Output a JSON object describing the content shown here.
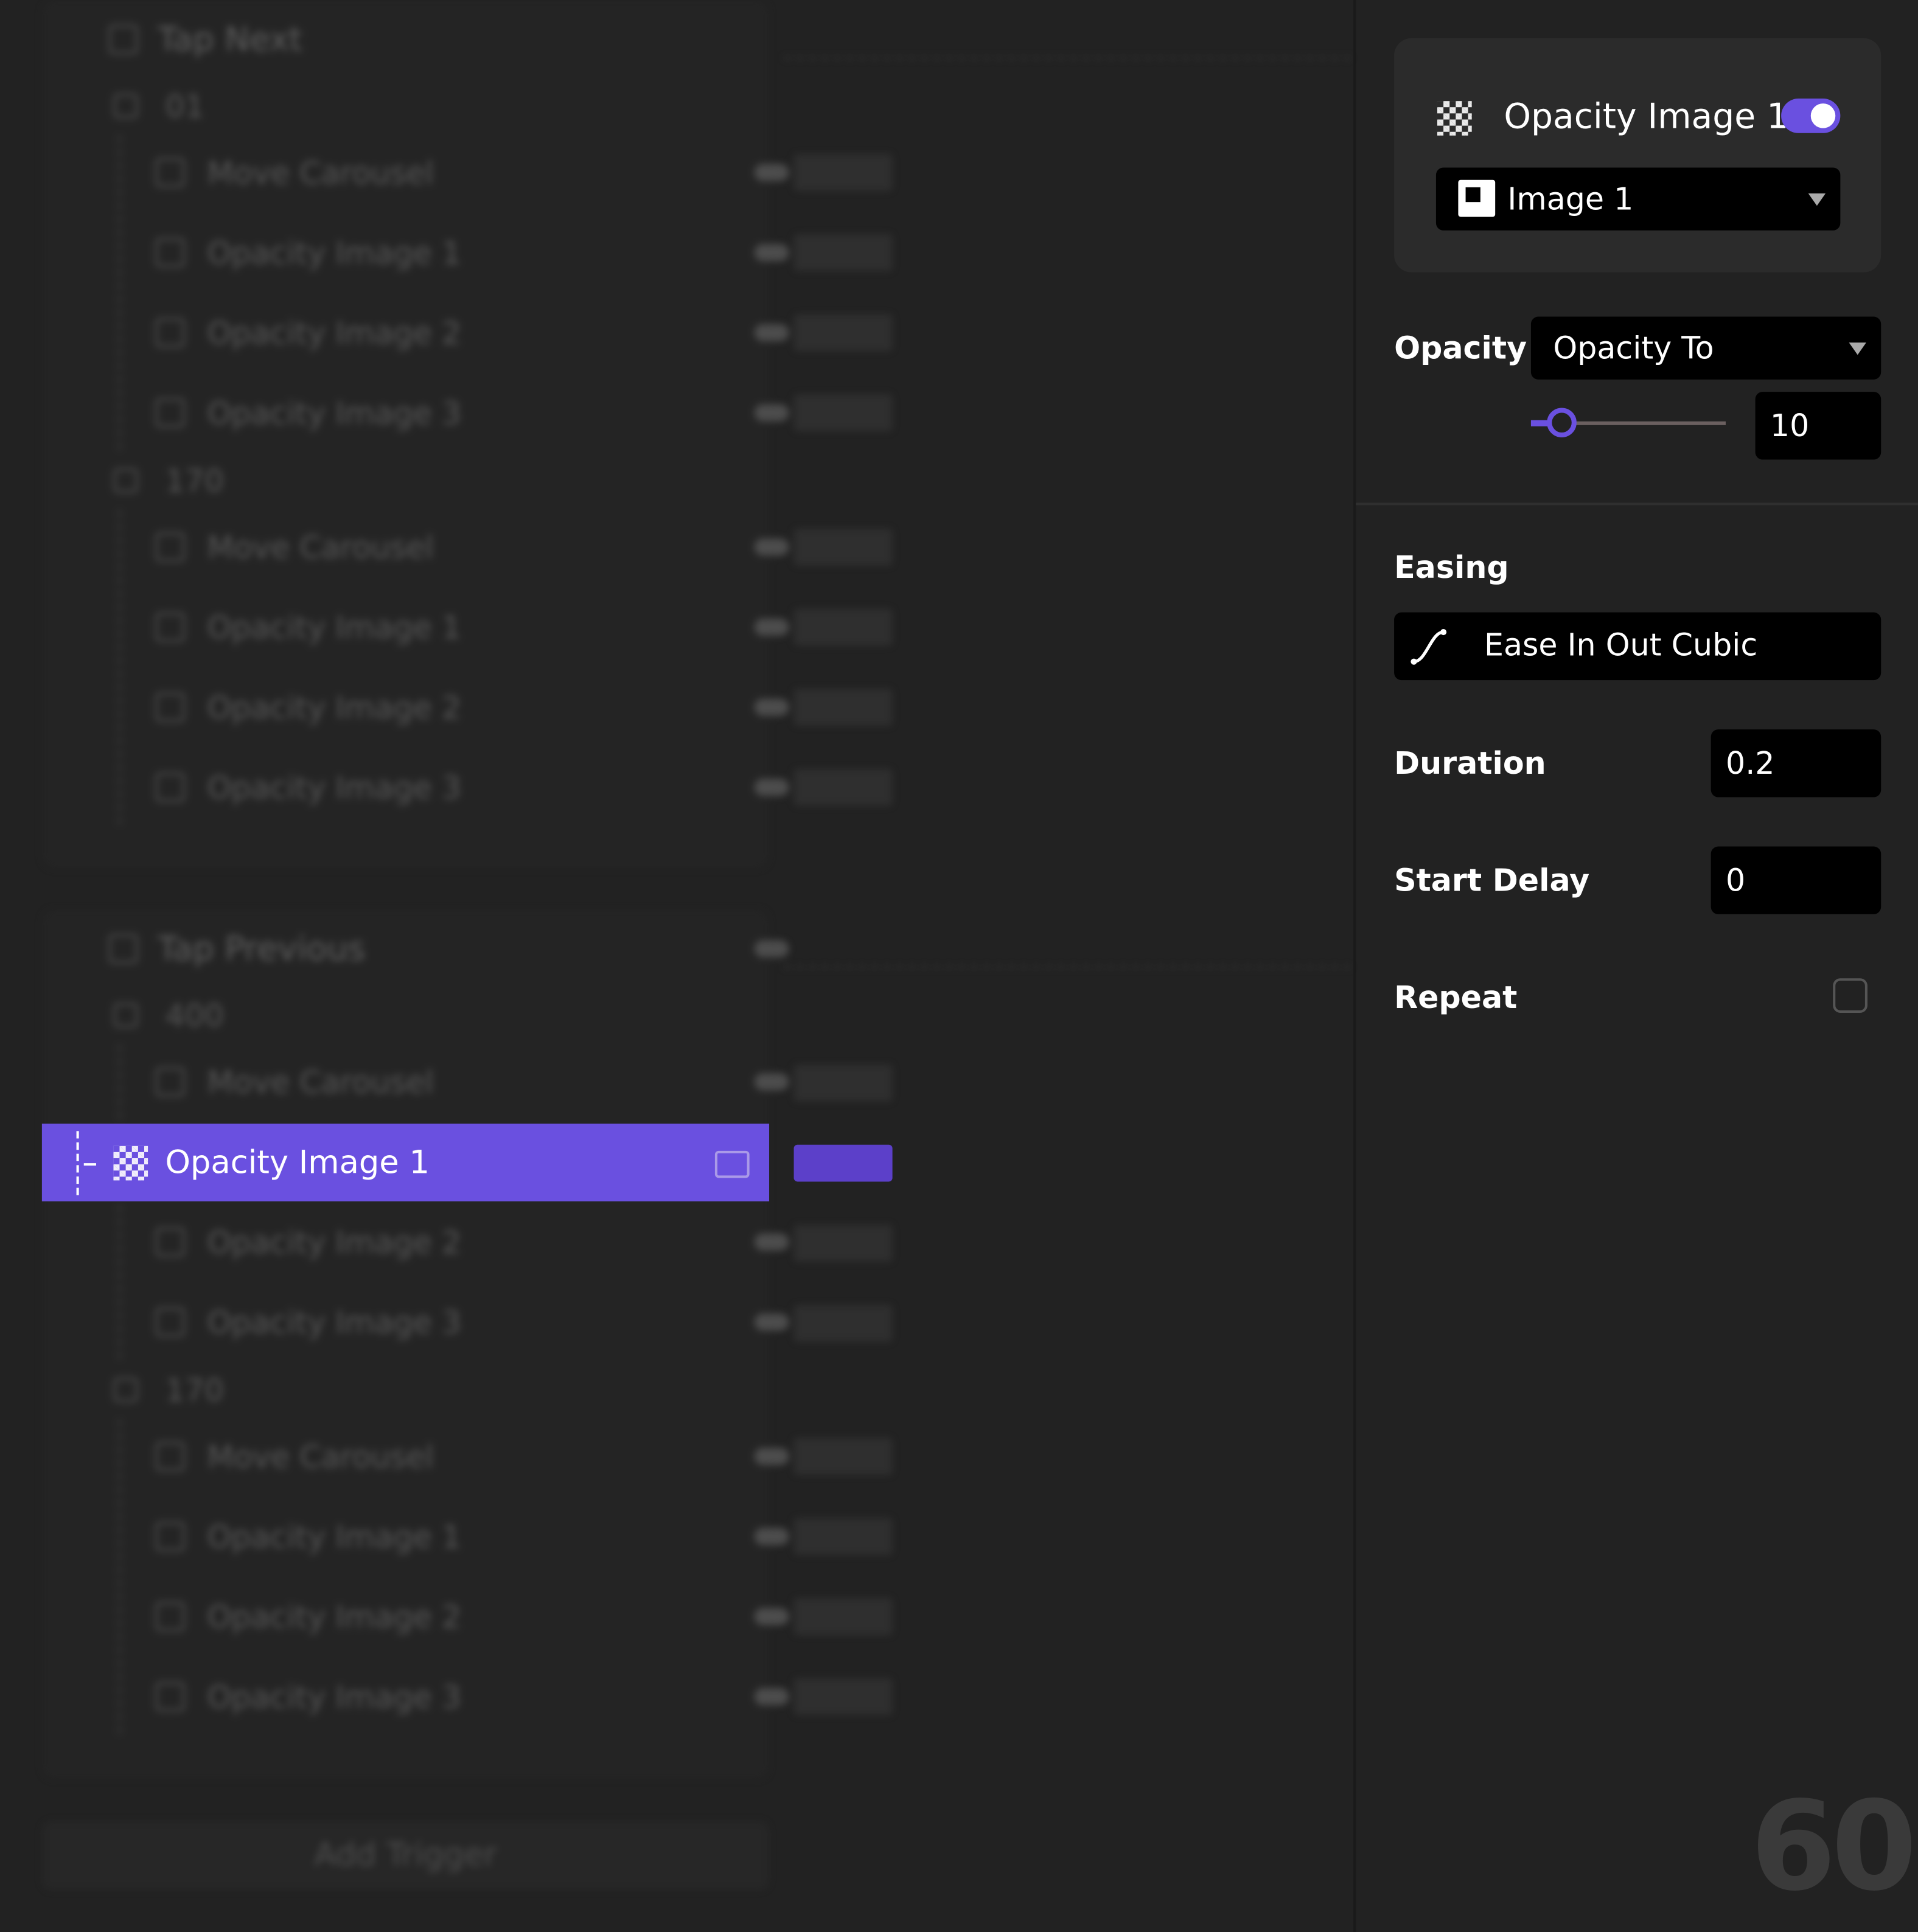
{
  "tree": {
    "triggers": [
      "Tap Next",
      "Tap Previous"
    ],
    "groups": [
      "01",
      "170",
      "400",
      "170"
    ],
    "items": [
      "Move Carousel",
      "Opacity Image 1",
      "Opacity Image 2",
      "Opacity Image 3"
    ],
    "selected_item": "Opacity Image 1",
    "add_trigger_label": "Add Trigger"
  },
  "panel": {
    "title": "Opacity Image 1",
    "enabled": true,
    "target": "Image 1",
    "opacity_label": "Opacity",
    "opacity_mode": "Opacity To",
    "opacity_value": "10",
    "easing_label": "Easing",
    "easing_value": "Ease In Out Cubic",
    "duration_label": "Duration",
    "duration_value": "0.2",
    "start_delay_label": "Start Delay",
    "start_delay_value": "0",
    "repeat_label": "Repeat",
    "repeat_checked": false
  },
  "fps_counter": "60",
  "colors": {
    "accent": "#6a50e0",
    "background": "#222222",
    "field": "#000000"
  }
}
